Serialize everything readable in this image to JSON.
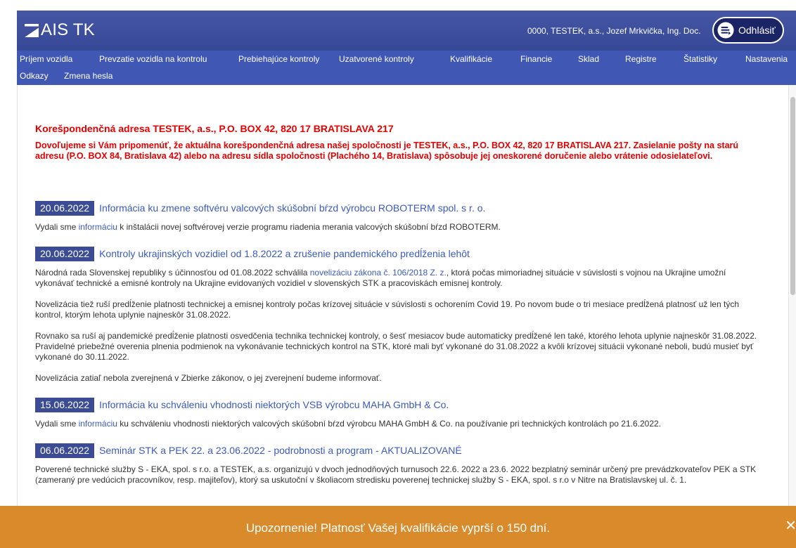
{
  "app": {
    "title": "AIS TK"
  },
  "header": {
    "user_info": "0000, TESTEK, a.s., Jozef Mrkvička, Ing. Doc.",
    "logout_label": "Odhlásiť"
  },
  "nav": {
    "row1": [
      "Príjem vozidla",
      "Prevzatie vozidla na kontrolu",
      "Prebiehajúce kontroly",
      "Uzatvorené kontroly",
      "Kvalifikácie",
      "Financie",
      "Sklad",
      "Registre",
      "Štatistiky",
      "Nastavenia"
    ],
    "row2": [
      "Odkazy",
      "Zmena hesla"
    ]
  },
  "notice": {
    "title": "Korešpondenčná adresa TESTEK, a.s., P.O. BOX 42, 820 17 BRATISLAVA 217",
    "text": "Dovoľujeme si Vám pripomenúť, že aktuálna korešpondenčná adresa našej spoločnosti je TESTEK, a.s., P.O. BOX 42, 820 17 BRATISLAVA 217. Zasielanie pošty na starú adresu (P.O. BOX 84, Bratislava 42) alebo na adresu sídla spoločnosti (Plachého 14, Bratislava) spôsobuje jej oneskorené doručenie alebo vrátenie odosielateľovi."
  },
  "news": [
    {
      "date": "20.06.2022",
      "title": "Informácia ku zmene softvéru valcových skúšobní bŕzd výrobcu ROBOTERM spol. s r. o.",
      "paragraphs": [
        {
          "before": "Vydali sme ",
          "link": "informáciu",
          "after": " k inštalácii novej softvérovej verzie programu riadenia merania valcových skúšobní bŕzd ROBOTERM."
        }
      ]
    },
    {
      "date": "20.06.2022",
      "title": "Kontroly ukrajinských vozidiel od 1.8.2022 a zrušenie pandemického predĺženia lehôt",
      "paragraphs": [
        {
          "before": "Národná rada Slovenskej republiky s účinnosťou od 01.08.2022 schválila ",
          "link": "novelizáciu zákona č. 106/2018 Z. z.",
          "after": ", ktorá počas mimoriadnej situácie v súvislosti s vojnou na Ukrajine umožní vykonávať technické a emisné kontroly na Ukrajine evidovaných vozidiel v slovenských STK a pracoviskách emisnej kontroly."
        },
        {
          "text": "Novelizácia tiež ruší predĺženie platnosti technickej a emisnej kontroly počas krízovej situácie v súvislosti s ochorením Covid 19. Po novom bude o tri mesiace predĺžená platnosť už len tých kontrol, ktorým lehota uplynie najneskôr 31.08.2022."
        },
        {
          "text": "Rovnako sa ruší aj pandemické predĺženie platnosti osvedčenia technika technickej kontroly, o šesť mesiacov bude automaticky predĺžené len také, ktorého lehota uplynie najneskôr 31.08.2022. Pravidelné priebežné overenia plnenia podmienok na vykonávanie technických kontrol na STK, ktoré mali byť vykonané do 31.08.2022 a kvôli krízovej situácii vykonané neboli, budú musieť byť vykonané do 30.11.2022."
        },
        {
          "text": "Novelizácia zatiaľ nebola zverejnená v Zbierke zákonov, o jej zverejnení budeme informovať."
        }
      ]
    },
    {
      "date": "15.06.2022",
      "title": "Informácia ku schváleniu vhodnosti niektorých VSB výrobcu MAHA GmbH & Co.",
      "paragraphs": [
        {
          "before": "Vydali sme ",
          "link": "informáciu",
          "after": " ku schváleniu vhodnosti niektorých valcových skúšobní bŕzd výrobcu MAHA GmbH & Co. na používanie pri technických kontrolách po 21.6.2022."
        }
      ]
    },
    {
      "date": "06.06.2022",
      "title": "Seminár STK a PEK 22. a 23.06.2022 - podrobnosti a program - AKTUALIZOVANÉ",
      "paragraphs": [
        {
          "text": "Poverené technické služby S - EKA, spol. s r.o. a TESTEK, a.s. organizujú v dvoch jednodňových turnusoch 22.6. 2022 a 23.6. 2022 bezplatný seminár určený pre prevádzkovateľov PEK a STK (zameraný pre vedúcich pracovníkov, resp. majiteľov), ktorý sa uskutoční v školiacom stredisku poverenej technickej služby S - EKA, spol. s r.o v Nitre na Bratislavskej ul. č. 1."
        }
      ]
    }
  ],
  "alert": {
    "text": "Upozornenie! Platnosť Vašej kvalifikácie vyprší o 150 dní.",
    "close_glyph": "×"
  },
  "icons": {
    "logo": "logo-icon",
    "logout": "logout-icon",
    "close": "close-icon"
  },
  "colors": {
    "header_bg": "#3a4d9f",
    "menu_bg": "#4057b4",
    "date_badge_bg": "#3b4c94",
    "link": "#3b5bbd",
    "warning_text": "#e60000",
    "alert_bg": "#d98b2c"
  }
}
